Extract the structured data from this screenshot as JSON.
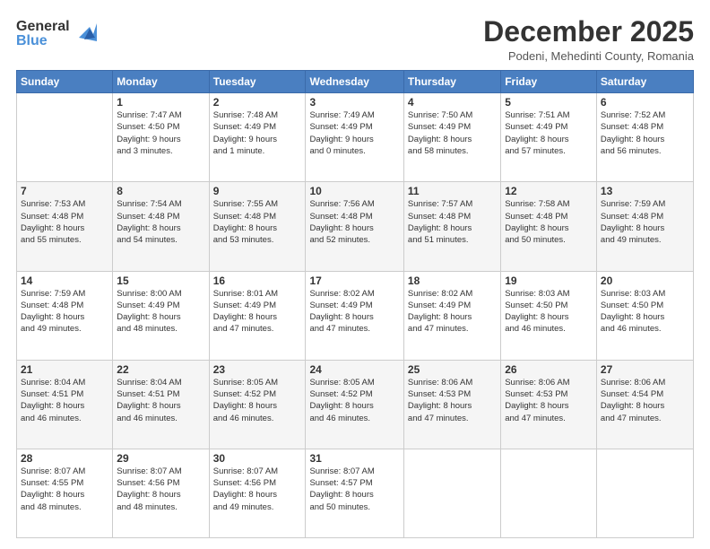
{
  "header": {
    "logo_general": "General",
    "logo_blue": "Blue",
    "month_title": "December 2025",
    "location": "Podeni, Mehedinti County, Romania"
  },
  "days_of_week": [
    "Sunday",
    "Monday",
    "Tuesday",
    "Wednesday",
    "Thursday",
    "Friday",
    "Saturday"
  ],
  "weeks": [
    [
      {
        "date": "",
        "info": ""
      },
      {
        "date": "1",
        "info": "Sunrise: 7:47 AM\nSunset: 4:50 PM\nDaylight: 9 hours\nand 3 minutes."
      },
      {
        "date": "2",
        "info": "Sunrise: 7:48 AM\nSunset: 4:49 PM\nDaylight: 9 hours\nand 1 minute."
      },
      {
        "date": "3",
        "info": "Sunrise: 7:49 AM\nSunset: 4:49 PM\nDaylight: 9 hours\nand 0 minutes."
      },
      {
        "date": "4",
        "info": "Sunrise: 7:50 AM\nSunset: 4:49 PM\nDaylight: 8 hours\nand 58 minutes."
      },
      {
        "date": "5",
        "info": "Sunrise: 7:51 AM\nSunset: 4:49 PM\nDaylight: 8 hours\nand 57 minutes."
      },
      {
        "date": "6",
        "info": "Sunrise: 7:52 AM\nSunset: 4:48 PM\nDaylight: 8 hours\nand 56 minutes."
      }
    ],
    [
      {
        "date": "7",
        "info": "Sunrise: 7:53 AM\nSunset: 4:48 PM\nDaylight: 8 hours\nand 55 minutes."
      },
      {
        "date": "8",
        "info": "Sunrise: 7:54 AM\nSunset: 4:48 PM\nDaylight: 8 hours\nand 54 minutes."
      },
      {
        "date": "9",
        "info": "Sunrise: 7:55 AM\nSunset: 4:48 PM\nDaylight: 8 hours\nand 53 minutes."
      },
      {
        "date": "10",
        "info": "Sunrise: 7:56 AM\nSunset: 4:48 PM\nDaylight: 8 hours\nand 52 minutes."
      },
      {
        "date": "11",
        "info": "Sunrise: 7:57 AM\nSunset: 4:48 PM\nDaylight: 8 hours\nand 51 minutes."
      },
      {
        "date": "12",
        "info": "Sunrise: 7:58 AM\nSunset: 4:48 PM\nDaylight: 8 hours\nand 50 minutes."
      },
      {
        "date": "13",
        "info": "Sunrise: 7:59 AM\nSunset: 4:48 PM\nDaylight: 8 hours\nand 49 minutes."
      }
    ],
    [
      {
        "date": "14",
        "info": "Sunrise: 7:59 AM\nSunset: 4:48 PM\nDaylight: 8 hours\nand 49 minutes."
      },
      {
        "date": "15",
        "info": "Sunrise: 8:00 AM\nSunset: 4:49 PM\nDaylight: 8 hours\nand 48 minutes."
      },
      {
        "date": "16",
        "info": "Sunrise: 8:01 AM\nSunset: 4:49 PM\nDaylight: 8 hours\nand 47 minutes."
      },
      {
        "date": "17",
        "info": "Sunrise: 8:02 AM\nSunset: 4:49 PM\nDaylight: 8 hours\nand 47 minutes."
      },
      {
        "date": "18",
        "info": "Sunrise: 8:02 AM\nSunset: 4:49 PM\nDaylight: 8 hours\nand 47 minutes."
      },
      {
        "date": "19",
        "info": "Sunrise: 8:03 AM\nSunset: 4:50 PM\nDaylight: 8 hours\nand 46 minutes."
      },
      {
        "date": "20",
        "info": "Sunrise: 8:03 AM\nSunset: 4:50 PM\nDaylight: 8 hours\nand 46 minutes."
      }
    ],
    [
      {
        "date": "21",
        "info": "Sunrise: 8:04 AM\nSunset: 4:51 PM\nDaylight: 8 hours\nand 46 minutes."
      },
      {
        "date": "22",
        "info": "Sunrise: 8:04 AM\nSunset: 4:51 PM\nDaylight: 8 hours\nand 46 minutes."
      },
      {
        "date": "23",
        "info": "Sunrise: 8:05 AM\nSunset: 4:52 PM\nDaylight: 8 hours\nand 46 minutes."
      },
      {
        "date": "24",
        "info": "Sunrise: 8:05 AM\nSunset: 4:52 PM\nDaylight: 8 hours\nand 46 minutes."
      },
      {
        "date": "25",
        "info": "Sunrise: 8:06 AM\nSunset: 4:53 PM\nDaylight: 8 hours\nand 47 minutes."
      },
      {
        "date": "26",
        "info": "Sunrise: 8:06 AM\nSunset: 4:53 PM\nDaylight: 8 hours\nand 47 minutes."
      },
      {
        "date": "27",
        "info": "Sunrise: 8:06 AM\nSunset: 4:54 PM\nDaylight: 8 hours\nand 47 minutes."
      }
    ],
    [
      {
        "date": "28",
        "info": "Sunrise: 8:07 AM\nSunset: 4:55 PM\nDaylight: 8 hours\nand 48 minutes."
      },
      {
        "date": "29",
        "info": "Sunrise: 8:07 AM\nSunset: 4:56 PM\nDaylight: 8 hours\nand 48 minutes."
      },
      {
        "date": "30",
        "info": "Sunrise: 8:07 AM\nSunset: 4:56 PM\nDaylight: 8 hours\nand 49 minutes."
      },
      {
        "date": "31",
        "info": "Sunrise: 8:07 AM\nSunset: 4:57 PM\nDaylight: 8 hours\nand 50 minutes."
      },
      {
        "date": "",
        "info": ""
      },
      {
        "date": "",
        "info": ""
      },
      {
        "date": "",
        "info": ""
      }
    ]
  ]
}
